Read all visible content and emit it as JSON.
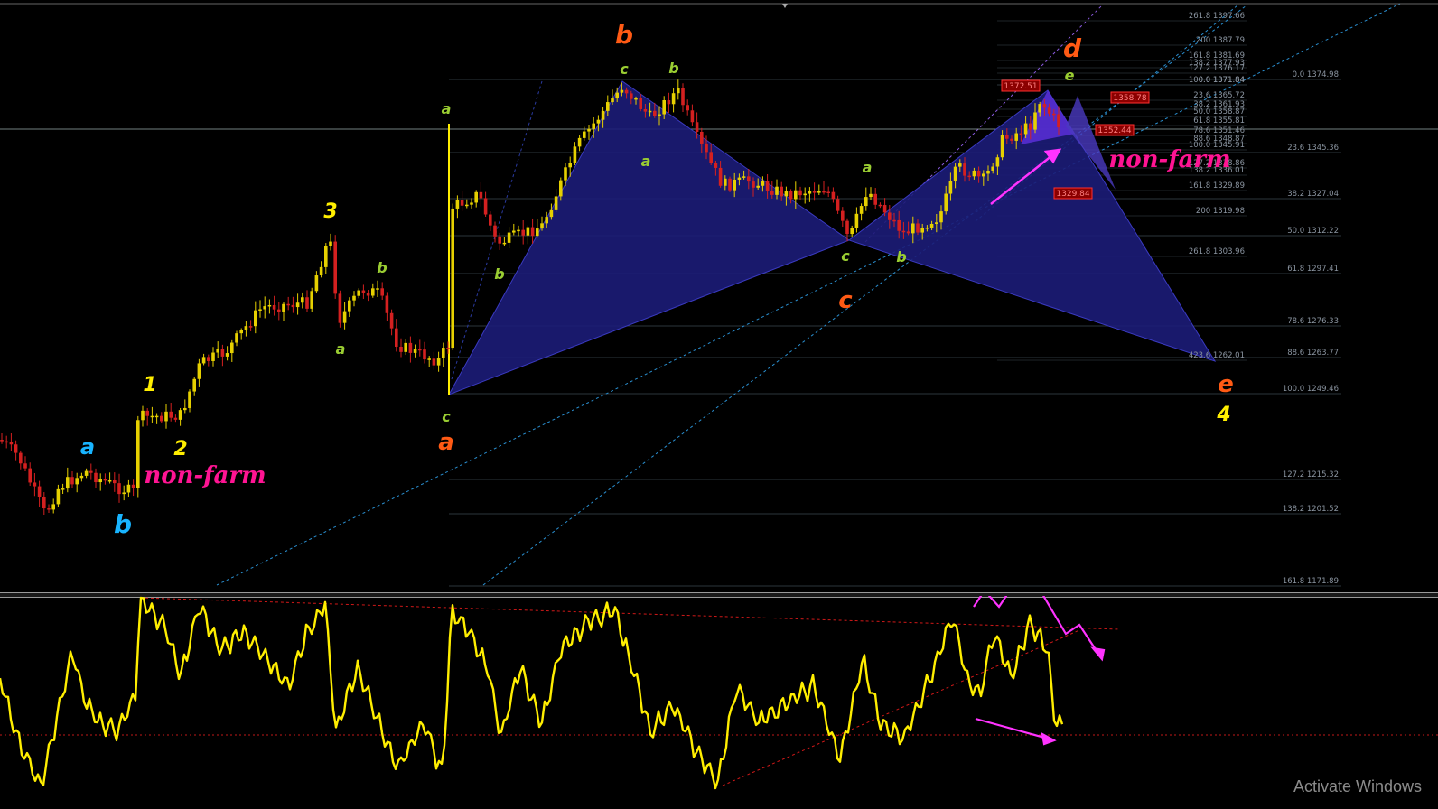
{
  "wave_labels": {
    "a_blue": "a",
    "b_blue": "b",
    "one": "1",
    "two": "2",
    "three": "3",
    "four": "4",
    "a_green_1": "a",
    "b_green_1": "b",
    "a_green_2": "a",
    "c_green_2": "c",
    "b_green_2": "b",
    "c_green_3": "c",
    "b_green_3": "b",
    "a_green_3": "a",
    "a_green_4": "a",
    "c_green_4": "c",
    "b_green_4": "b",
    "e_green": "e",
    "b_orange": "b",
    "a_orange": "a",
    "c_orange": "c",
    "d_orange": "d",
    "e_orange": "e"
  },
  "annotations": {
    "nonfarm_1": "non-farm",
    "nonfarm_2": "non-farm"
  },
  "fib_levels_right": [
    "0.0 1374.98",
    "23.6 1345.36",
    "38.2 1327.04",
    "50.0 1312.22",
    "61.8 1297.41",
    "78.6 1276.33",
    "88.6 1263.77",
    "100.0 1249.46",
    "127.2 1215.32",
    "138.2 1201.52",
    "161.8 1171.89"
  ],
  "fib_levels_mid": [
    "261.8 1397.66",
    "200 1387.79",
    "161.8 1381.69",
    "138.2 1377.93",
    "127.2 1376.17",
    "100.0 1371.84",
    "0.0 1371.84",
    "23.6 1365.72",
    "38.2 1361.93",
    "50.0 1358.87",
    "61.8 1355.81",
    "78.6 1351.46",
    "88.6 1348.87",
    "100.0 1345.91",
    "127.2 1338.86",
    "138.2 1336.01",
    "161.8 1329.89",
    "200 1319.98",
    "261.8 1303.96",
    "423.6 1262.01"
  ],
  "price_boxes": [
    "1372.51",
    "1358.78",
    "1352.44",
    "1329.84"
  ],
  "watermark": "Activate Windows",
  "colors": {
    "background": "#000000",
    "harmonic_fill": "#1c1c78",
    "harmonic_stroke": "#3a3ac0",
    "candle_bull": "#e6d000",
    "candle_bear": "#d42020",
    "oscillator": "#ffee00",
    "channel": "#2a8fd0",
    "wave_blue": "#18b4ff",
    "wave_yellow": "#ffee00",
    "wave_green": "#9acd32",
    "wave_orange": "#ff5a14",
    "annotation_magenta": "#ff1493",
    "arrow_magenta": "#ff33ff",
    "divergence_red": "#d01818"
  }
}
